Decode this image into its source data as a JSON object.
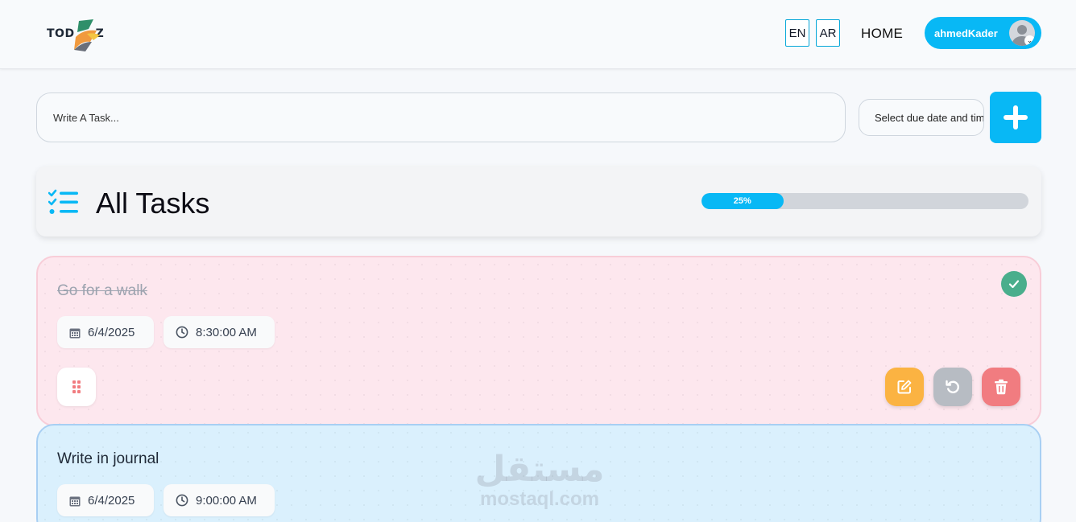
{
  "header": {
    "logo_left": "TOD",
    "logo_right": "Z",
    "lang_en": "EN",
    "lang_ar": "AR",
    "home": "HOME",
    "username": "ahmedKader"
  },
  "new_task": {
    "placeholder": "Write A Task...",
    "due_date_placeholder": "Select due date and time"
  },
  "tasks_header": {
    "title": "All Tasks",
    "progress_label": "25%",
    "progress_value": 0.25
  },
  "tasks": [
    {
      "title": "Go for a walk",
      "date": "6/4/2025",
      "time": "8:30:00 AM",
      "completed": true,
      "color": "#fde7ee"
    },
    {
      "title": "Write in journal",
      "date": "6/4/2025",
      "time": "9:00:00 AM",
      "completed": false,
      "color": "#daf0fd"
    }
  ],
  "watermark": {
    "arabic": "مستقل",
    "latin": "mostaql.com"
  },
  "colors": {
    "accent": "#08b8f5",
    "edit": "#fbb342",
    "undo": "#b7bcc3",
    "delete": "#f17c80",
    "done": "#4aae8c"
  }
}
